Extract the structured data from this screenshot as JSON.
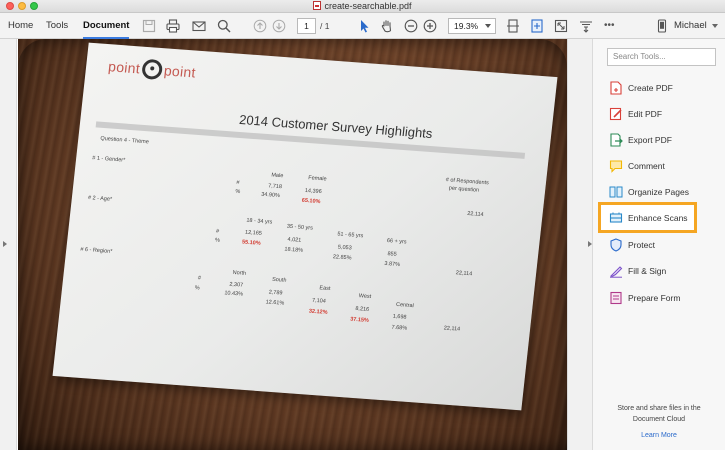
{
  "window": {
    "title": "create-searchable.pdf"
  },
  "toolbar": {
    "tabs": [
      {
        "label": "Home"
      },
      {
        "label": "Tools"
      },
      {
        "label": "Document",
        "active": true
      }
    ],
    "page_current": "1",
    "page_total": "/ 1",
    "zoom": "19.3%",
    "user": "Michael",
    "more_label": "•••"
  },
  "document": {
    "logo_left": "point",
    "logo_right": "point",
    "title": "2014 Customer Survey Highlights",
    "question": "Question 4 - Theme",
    "q1_label": "# 1 - Gender*",
    "q2_label": "# 2 - Age*",
    "q6_label": "# 6 - Region*",
    "respondents_header_1": "# of Respondents",
    "respondents_header_2": "per question",
    "hash": "#",
    "pct": "%",
    "gender": {
      "cols": [
        "Male",
        "Female"
      ],
      "counts": [
        "7,718",
        "14,396"
      ],
      "pcts": [
        "34.90%",
        "65.10%"
      ],
      "total": "22,114"
    },
    "age": {
      "cols": [
        "18 - 34 yrs",
        "35 - 50 yrs",
        "51 - 65 yrs",
        "66 + yrs"
      ],
      "counts": [
        "12,165",
        "4,021",
        "5,053",
        "855"
      ],
      "pcts": [
        "55.10%",
        "18.18%",
        "22.85%",
        "3.87%"
      ],
      "total": "22,114"
    },
    "region": {
      "cols": [
        "North",
        "South",
        "East",
        "West",
        "Central"
      ],
      "counts": [
        "2,307",
        "2,789",
        "7,104",
        "8,216",
        "1,698"
      ],
      "pcts": [
        "10.43%",
        "12.61%",
        "32.12%",
        "37.15%",
        "7.68%"
      ],
      "total": "22,114"
    }
  },
  "tools": {
    "search_placeholder": "Search Tools...",
    "items": [
      {
        "label": "Create PDF",
        "icon": "create-pdf-icon",
        "color": "#d9413a"
      },
      {
        "label": "Edit PDF",
        "icon": "edit-pdf-icon",
        "color": "#d9413a"
      },
      {
        "label": "Export PDF",
        "icon": "export-pdf-icon",
        "color": "#2e8b57"
      },
      {
        "label": "Comment",
        "icon": "comment-icon",
        "color": "#f2b705"
      },
      {
        "label": "Organize Pages",
        "icon": "organize-pages-icon",
        "color": "#2a89c9"
      },
      {
        "label": "Enhance Scans",
        "icon": "enhance-scans-icon",
        "color": "#2a89c9",
        "highlighted": true
      },
      {
        "label": "Protect",
        "icon": "protect-icon",
        "color": "#2a6acb"
      },
      {
        "label": "Fill & Sign",
        "icon": "fill-sign-icon",
        "color": "#7b52c9"
      },
      {
        "label": "Prepare Form",
        "icon": "prepare-form-icon",
        "color": "#b03a8a"
      }
    ],
    "cloud_text_1": "Store and share files in the",
    "cloud_text_2": "Document Cloud",
    "learn_more": "Learn More"
  },
  "colors": {
    "accent": "#3a7be0",
    "highlight": "#f5a623"
  }
}
